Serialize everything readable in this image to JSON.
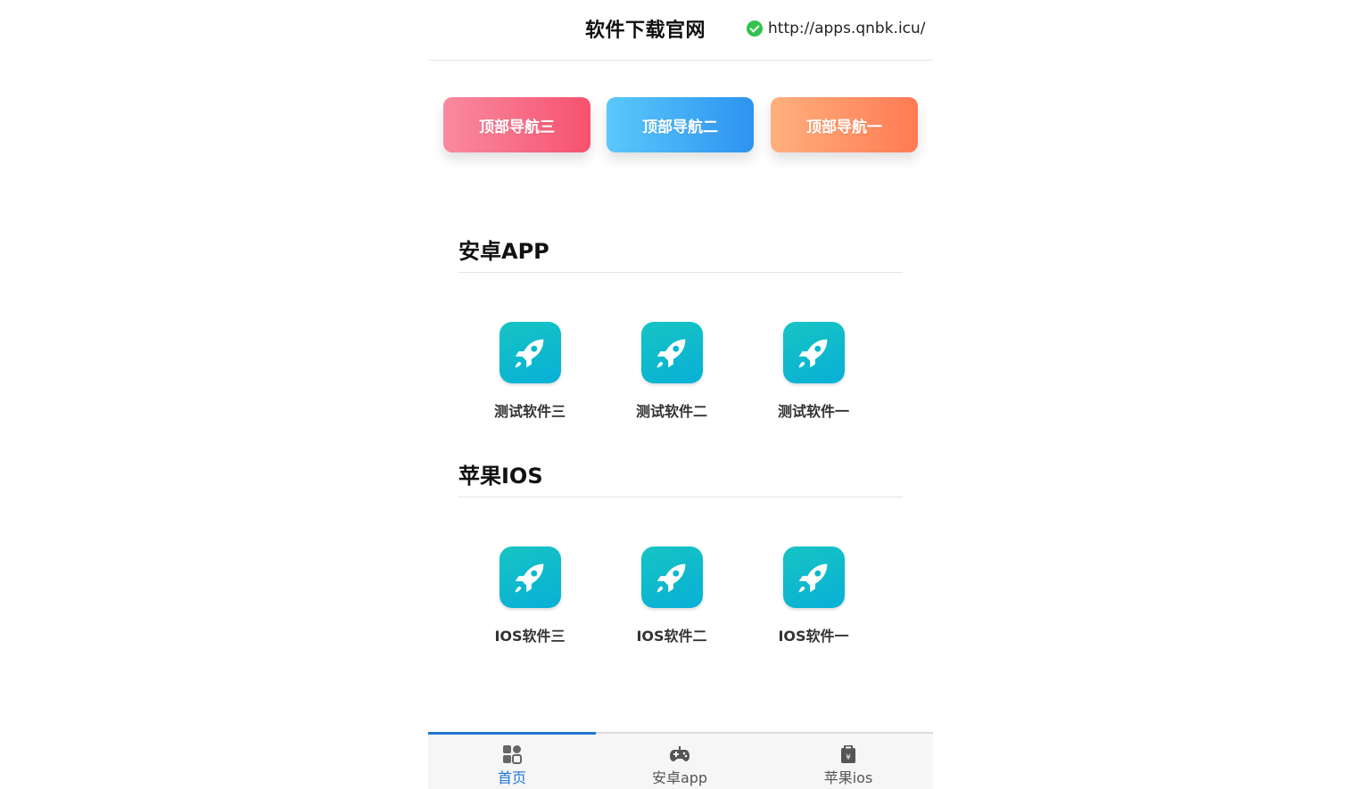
{
  "header": {
    "title": "软件下载官网",
    "url": "http://apps.qnbk.icu/"
  },
  "topnav": [
    {
      "label": "顶部导航三"
    },
    {
      "label": "顶部导航二"
    },
    {
      "label": "顶部导航一"
    }
  ],
  "sections": [
    {
      "title": "安卓APP",
      "apps": [
        {
          "name": "测试软件三",
          "icon": "rocket-icon"
        },
        {
          "name": "测试软件二",
          "icon": "rocket-icon"
        },
        {
          "name": "测试软件一",
          "icon": "rocket-icon"
        }
      ]
    },
    {
      "title": "苹果IOS",
      "apps": [
        {
          "name": "IOS软件三",
          "icon": "rocket-icon"
        },
        {
          "name": "IOS软件二",
          "icon": "rocket-icon"
        },
        {
          "name": "IOS软件一",
          "icon": "rocket-icon"
        }
      ]
    }
  ],
  "tabbar": [
    {
      "label": "首页",
      "icon": "grid-icon",
      "active": true
    },
    {
      "label": "安卓app",
      "icon": "gamepad-icon",
      "active": false
    },
    {
      "label": "苹果ios",
      "icon": "store-icon",
      "active": false
    }
  ],
  "colors": {
    "accent": "#1f77d0",
    "app_icon": "#0bb8cf",
    "nav_pink": "#f6526f",
    "nav_blue": "#2d93f0",
    "nav_orange": "#ff7a52",
    "check_green": "#33c24d"
  }
}
